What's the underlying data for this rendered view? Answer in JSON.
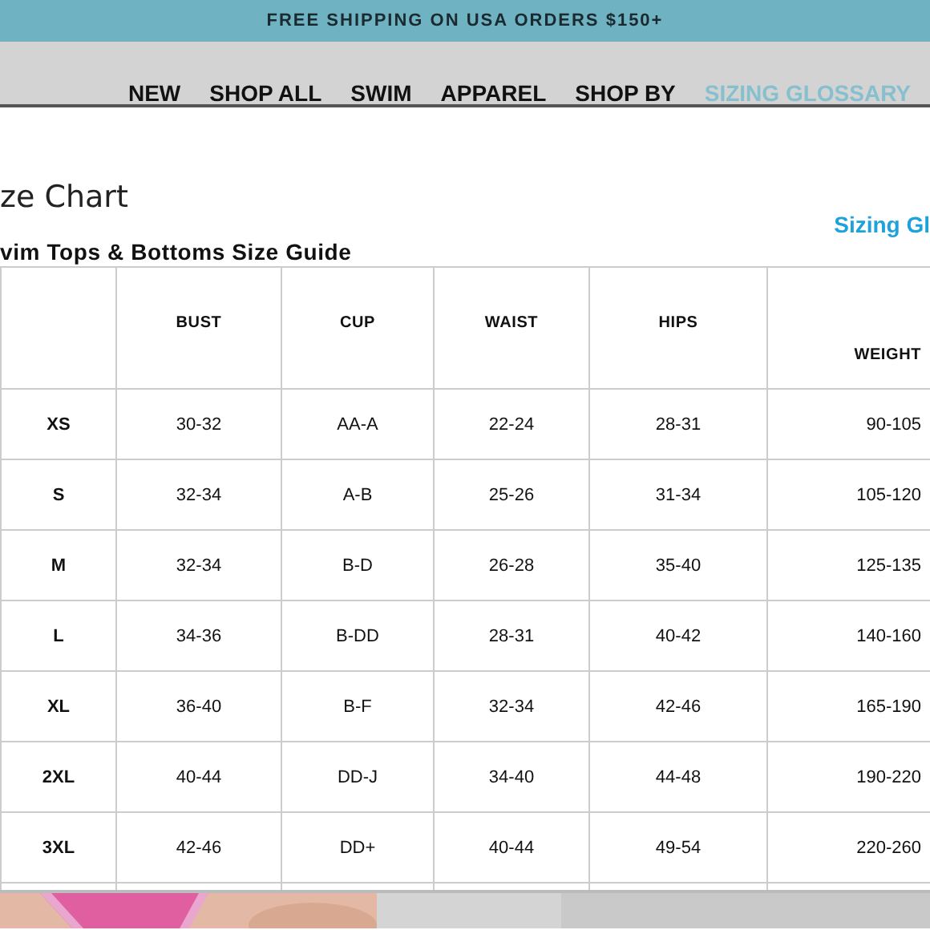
{
  "promo_bar": {
    "text": "FREE SHIPPING ON USA ORDERS $150+"
  },
  "nav": [
    {
      "label": "NEW",
      "selected": false
    },
    {
      "label": "SHOP ALL",
      "selected": false
    },
    {
      "label": "SWIM",
      "selected": false
    },
    {
      "label": "APPAREL",
      "selected": false
    },
    {
      "label": "SHOP BY",
      "selected": false
    },
    {
      "label": "SIZING GLOSSARY",
      "selected": true
    }
  ],
  "modal": {
    "title": "ze Chart",
    "link": "Sizing Gl",
    "subtitle": "vim Tops & Bottoms Size Guide"
  },
  "table": {
    "columns": [
      "",
      "BUST",
      "CUP",
      "WAIST",
      "HIPS",
      "WEIGHT"
    ],
    "rows": [
      [
        "XS",
        "30-32",
        "AA-A",
        "22-24",
        "28-31",
        "90-105"
      ],
      [
        "S",
        "32-34",
        "A-B",
        "25-26",
        "31-34",
        "105-120"
      ],
      [
        "M",
        "32-34",
        "B-D",
        "26-28",
        "35-40",
        "125-135"
      ],
      [
        "L",
        "34-36",
        "B-DD",
        "28-31",
        "40-42",
        "140-160"
      ],
      [
        "XL",
        "36-40",
        "B-F",
        "32-34",
        "42-46",
        "165-190"
      ],
      [
        "2XL",
        "40-44",
        "DD-J",
        "34-40",
        "44-48",
        "190-220"
      ],
      [
        "3XL",
        "42-46",
        "DD+",
        "40-44",
        "49-54",
        "220-260"
      ]
    ]
  }
}
